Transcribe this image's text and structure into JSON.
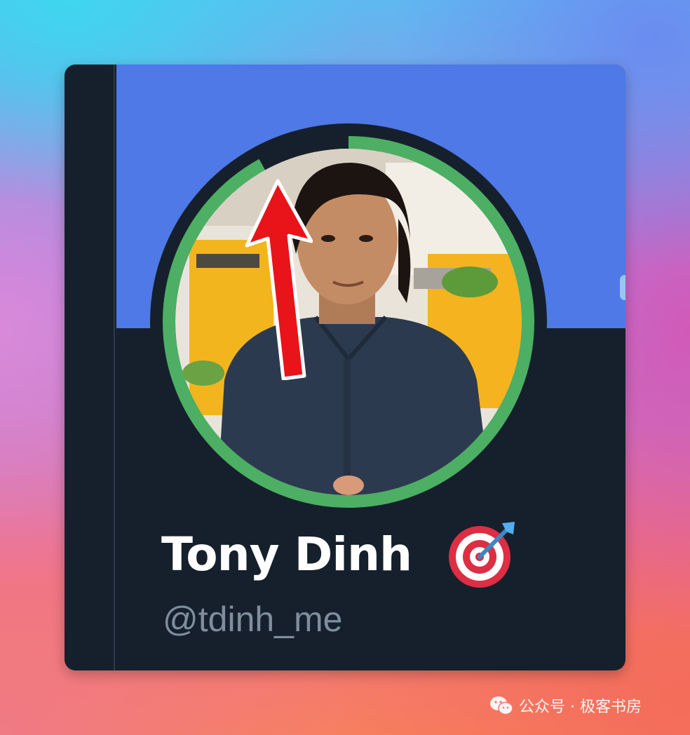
{
  "profile": {
    "display_name": "Tony Dinh",
    "handle": "@tdinh_me",
    "name_emoji": "direct-hit-target-icon"
  },
  "avatar": {
    "ring_color": "#4caf63",
    "ring_progress": 0.92,
    "highlight_arrow_color": "#e8141a"
  },
  "colors": {
    "banner": "#4e79e6",
    "card_background": "#16202c",
    "handle_text": "#7f8e9c"
  },
  "watermark": {
    "text": "公众号 · 极客书房"
  }
}
